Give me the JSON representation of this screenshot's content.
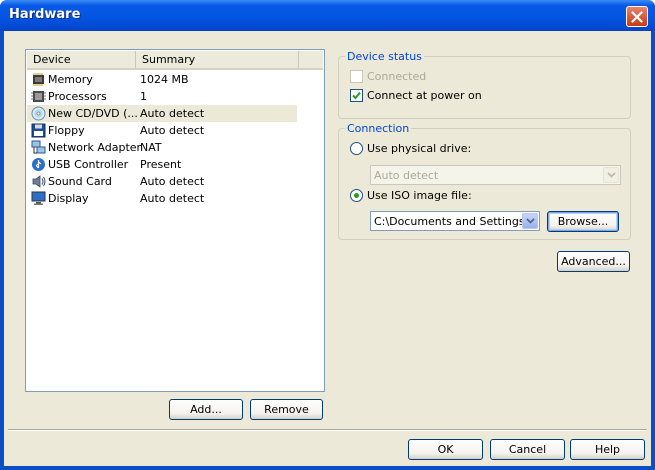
{
  "window": {
    "title": "Hardware"
  },
  "device_list": {
    "columns": [
      "Device",
      "Summary"
    ],
    "rows": [
      {
        "device": "Memory",
        "summary": "1024 MB",
        "icon": "memory-icon"
      },
      {
        "device": "Processors",
        "summary": "1",
        "icon": "processor-icon"
      },
      {
        "device": "New CD/DVD (...",
        "summary": "Auto detect",
        "icon": "cd-dvd-icon",
        "selected": true
      },
      {
        "device": "Floppy",
        "summary": "Auto detect",
        "icon": "floppy-icon"
      },
      {
        "device": "Network Adapter",
        "summary": "NAT",
        "icon": "network-adapter-icon"
      },
      {
        "device": "USB Controller",
        "summary": "Present",
        "icon": "usb-icon"
      },
      {
        "device": "Sound Card",
        "summary": "Auto detect",
        "icon": "sound-card-icon"
      },
      {
        "device": "Display",
        "summary": "Auto detect",
        "icon": "display-icon"
      }
    ],
    "add_label": "Add...",
    "remove_label": "Remove"
  },
  "device_status": {
    "legend": "Device status",
    "connected_label": "Connected",
    "connected_checked": false,
    "connect_at_power_on_label": "Connect at power on",
    "connect_at_power_on_checked": true
  },
  "connection": {
    "legend": "Connection",
    "physical_label": "Use physical drive:",
    "physical_value": "Auto detect",
    "iso_label": "Use ISO image file:",
    "iso_value": "C:\\Documents and Settings\\",
    "browse_label": "Browse...",
    "selected": "iso"
  },
  "advanced_label": "Advanced...",
  "footer": {
    "ok_label": "OK",
    "cancel_label": "Cancel",
    "help_label": "Help"
  },
  "colors": {
    "title_bar": "#0454e2",
    "dialog_bg": "#ece9d8",
    "group_legend": "#0046d5",
    "radio_dot": "#21a121"
  }
}
